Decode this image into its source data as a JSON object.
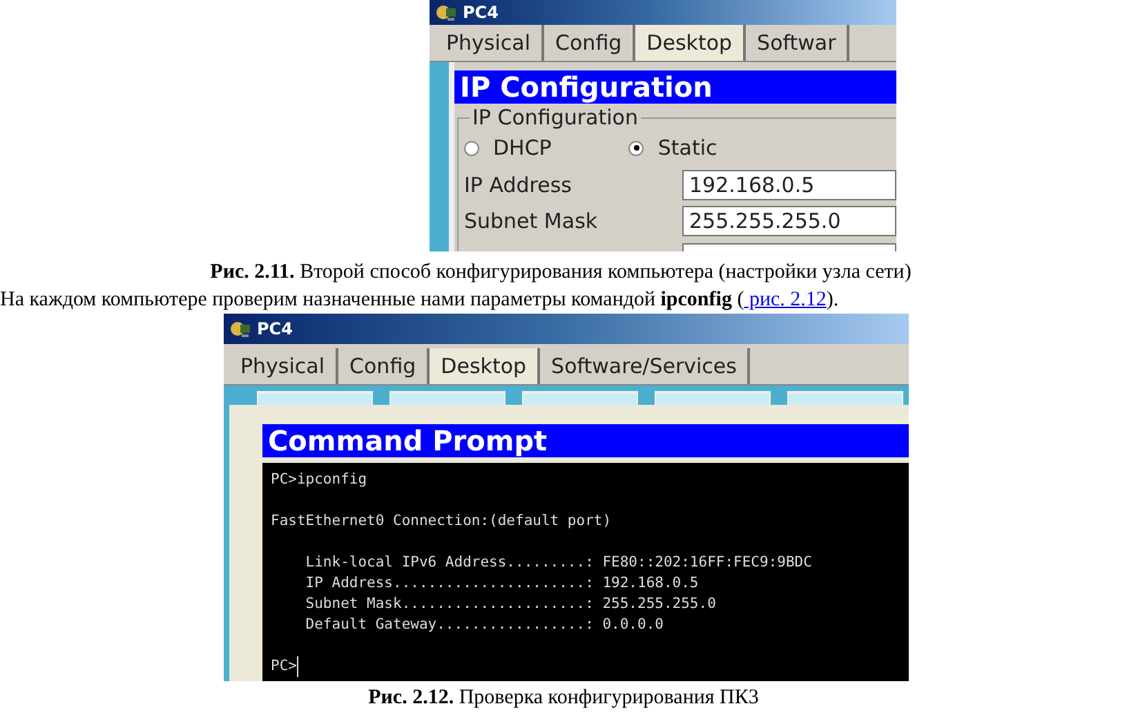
{
  "figure_1": {
    "window": {
      "title": "PC4"
    },
    "tabs": [
      {
        "label": "Physical",
        "selected": false
      },
      {
        "label": "Config",
        "selected": false
      },
      {
        "label": "Desktop",
        "selected": true
      },
      {
        "label": "Softwar",
        "selected": false
      }
    ],
    "heading": "IP Configuration",
    "group": {
      "title": "IP Configuration",
      "radios": [
        {
          "label": "DHCP",
          "selected": false
        },
        {
          "label": "Static",
          "selected": true
        }
      ],
      "fields": [
        {
          "label": "IP Address",
          "value": "192.168.0.5"
        },
        {
          "label": "Subnet Mask",
          "value": "255.255.255.0"
        }
      ]
    }
  },
  "caption_1": "**Рис. 2.11.** Второй способ конфигурирования компьютера (настройки узла сети)",
  "paragraph": {
    "text": "На каждом компьютере проверим назначенные нами параметры командой **ipconfig** (",
    "link": " рис. 2.12",
    "text_after": ")."
  },
  "figure_2": {
    "window": {
      "title": "PC4"
    },
    "tabs": [
      {
        "label": "Physical",
        "selected": false
      },
      {
        "label": "Config",
        "selected": false
      },
      {
        "label": "Desktop",
        "selected": true
      },
      {
        "label": "Software/Services",
        "selected": false
      }
    ],
    "heading": "Command Prompt",
    "terminal": [
      {
        "cursor": false,
        "lines": [
          "PC>ipconfig"
        ]
      },
      {
        "cursor": false,
        "lines": [
          "FastEthernet0 Connection:(default port)"
        ]
      },
      {
        "cursor": false,
        "lines": [
          "    Link-local IPv6 Address.........: FE80::202:16FF:FEC9:9BDC",
          "    IP Address......................: 192.168.0.5",
          "    Subnet Mask.....................: 255.255.255.0",
          "    Default Gateway.................: 0.0.0.0"
        ]
      },
      {
        "cursor": true,
        "lines": [
          "PC>"
        ]
      }
    ]
  },
  "caption_2": "**Рис. 2.12.** Проверка конфигурирования ПК3"
}
